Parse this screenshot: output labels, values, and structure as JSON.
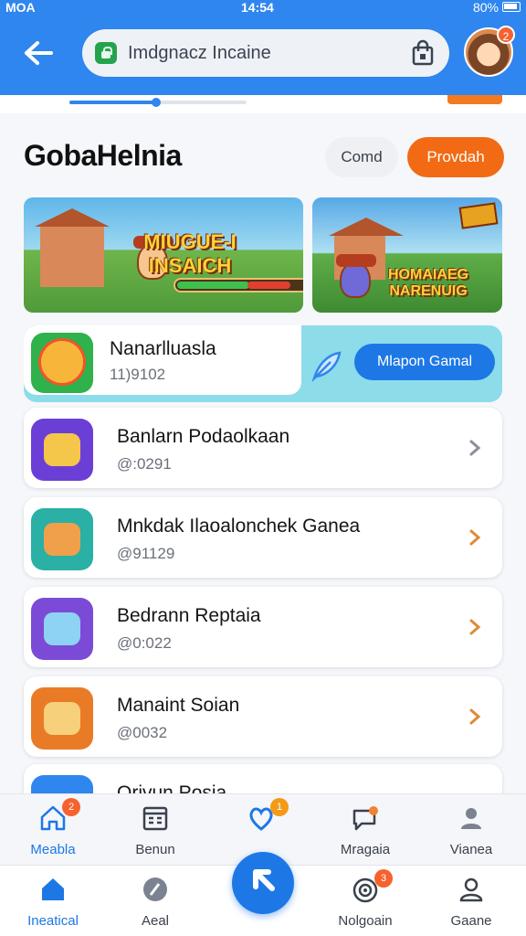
{
  "status": {
    "left": "MOA",
    "time": "14:54",
    "battery": "80%"
  },
  "header": {
    "search_text": "Imdgnacz Incaine",
    "avatar_badge": "2"
  },
  "section": {
    "title": "GobaHelnia",
    "btn_ghost": "Comd",
    "btn_orange": "Provdah"
  },
  "banners": [
    {
      "title": "MIUGUE-I INSAICH"
    },
    {
      "title": "HOMAIAEG NARENUIG"
    }
  ],
  "featured": {
    "title": "Nanarlluasla",
    "sub": "11)9102",
    "cta": "Mlapon Gamal"
  },
  "list": [
    {
      "name": "Banlarn Podaolkaan",
      "handle": "@:0291",
      "icon_color": "#6b3fd6",
      "chev_color": "#8a8f98"
    },
    {
      "name": "Mnkdak Ilaoalonchek Ganea",
      "handle": "@91129",
      "icon_color": "#2ab0a4",
      "chev_color": "#e08a3a"
    },
    {
      "name": "Bedrann Reptaia",
      "handle": "@0:022",
      "icon_color": "#7b4bd8",
      "chev_color": "#e08a3a"
    },
    {
      "name": "Manaint Soian",
      "handle": "@0032",
      "icon_color": "#ea7b26",
      "chev_color": "#e08a3a"
    }
  ],
  "peek": {
    "name": "Qrivun Posia"
  },
  "nav_top": [
    {
      "label": "Meabla",
      "icon": "home-icon",
      "badge": "2"
    },
    {
      "label": "Benun",
      "icon": "calendar-icon"
    },
    {
      "label": "",
      "icon": "heart-chat-icon",
      "badge": "1"
    },
    {
      "label": "Mragaia",
      "icon": "chat-bubble-icon"
    },
    {
      "label": "Vianea",
      "icon": "person-icon"
    }
  ],
  "nav_bottom": [
    {
      "label": "Ineatical",
      "icon": "home-icon"
    },
    {
      "label": "Aeal",
      "icon": "globe-icon"
    },
    {
      "label": "Nolgoain",
      "icon": "target-icon",
      "badge": "3"
    },
    {
      "label": "Gaane",
      "icon": "person-icon"
    }
  ],
  "colors": {
    "brand": "#2f86ee",
    "accent": "#f26a14",
    "badge": "#f5622e"
  }
}
